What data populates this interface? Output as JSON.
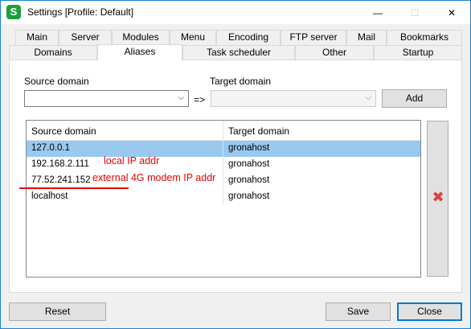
{
  "window": {
    "title": "Settings [Profile: Default]",
    "icon_letter": "S",
    "controls": {
      "minimize": "—",
      "maximize": "☐",
      "close": "✕"
    }
  },
  "tabs": {
    "row1": [
      "Main",
      "Server",
      "Modules",
      "Menu",
      "Encoding",
      "FTP server",
      "Mail",
      "Bookmarks"
    ],
    "row2": [
      "Domains",
      "Aliases",
      "Task scheduler",
      "Other",
      "Startup"
    ],
    "active": "Aliases"
  },
  "aliases": {
    "source_label": "Source domain",
    "target_label": "Target domain",
    "arrow": "=>",
    "source_value": "",
    "target_value": "",
    "add_button": "Add",
    "columns": [
      "Source domain",
      "Target domain"
    ],
    "rows": [
      {
        "source": "127.0.0.1",
        "target": "gronahost",
        "selected": true
      },
      {
        "source": "192.168.2.111",
        "target": "gronahost",
        "selected": false
      },
      {
        "source": "77.52.241.152",
        "target": "gronahost",
        "selected": false
      },
      {
        "source": "localhost",
        "target": "gronahost",
        "selected": false
      }
    ],
    "annotations": {
      "local": "local IP addr",
      "external": "external 4G modem IP addr",
      "color": "#e60000"
    }
  },
  "footer": {
    "reset": "Reset",
    "save": "Save",
    "close": "Close"
  },
  "colors": {
    "selection": "#99c9ef",
    "accent": "#0078d7"
  }
}
